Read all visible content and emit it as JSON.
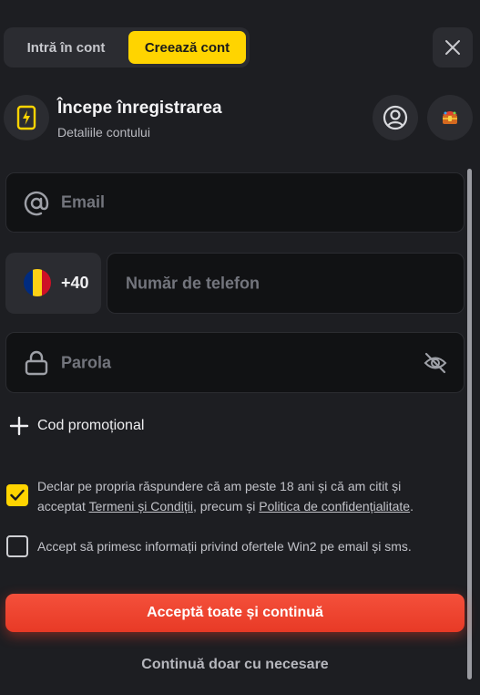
{
  "tabs": {
    "login_label": "Intră în cont",
    "register_label": "Creează cont"
  },
  "header": {
    "title": "Începe înregistrarea",
    "subtitle": "Detaliile contului"
  },
  "form": {
    "email_placeholder": "Email",
    "phone_code": "+40",
    "phone_placeholder": "Număr de telefon",
    "password_placeholder": "Parola",
    "promo_label": "Cod promoțional"
  },
  "consents": {
    "age": {
      "checked": true,
      "text_before": "Declar pe propria răspundere că am peste 18 ani și că am citit și acceptat ",
      "terms_link": "Termeni și Condiții",
      "text_middle": ", precum și ",
      "privacy_link": "Politica de confidențialitate",
      "text_after": "."
    },
    "marketing": {
      "checked": false,
      "text": "Accept să primesc informații privind ofertele Win2 pe email și sms."
    }
  },
  "buttons": {
    "accept_all": "Acceptă toate și continuă",
    "necessary_only": "Continuă doar cu necesare"
  },
  "icons": {
    "close": "close-icon",
    "bolt": "lightning-bolt-icon",
    "user": "user-icon",
    "gift": "treasure-chest-icon",
    "at": "at-sign-icon",
    "flag": "romania-flag-icon",
    "lock": "lock-icon",
    "eye": "eye-off-icon",
    "plus": "plus-icon",
    "check": "checkmark-icon"
  },
  "colors": {
    "background": "#1d1e22",
    "accent_yellow": "#ffd400",
    "primary_red": "#f0442f",
    "field_bg": "#111214",
    "flag": [
      "#002b7f",
      "#fcd116",
      "#ce1126"
    ]
  }
}
